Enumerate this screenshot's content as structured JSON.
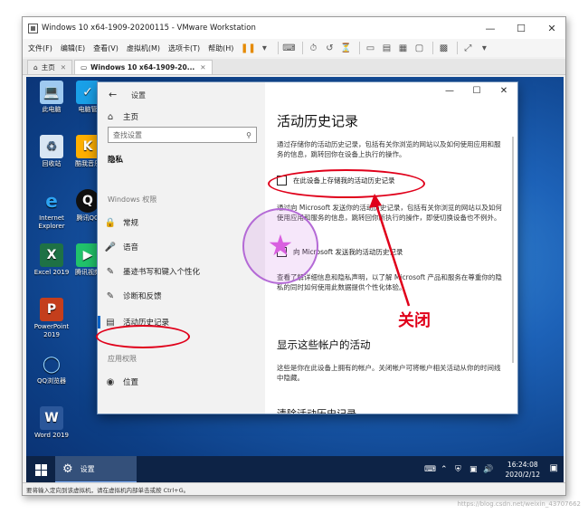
{
  "window": {
    "title": "Windows 10 x64-1909-20200115 - VMware Workstation"
  },
  "menubar": {
    "items": [
      "文件(F)",
      "编辑(E)",
      "查看(V)",
      "虚拟机(M)",
      "选项卡(T)",
      "帮助(H)"
    ],
    "toolbar_icons": [
      "pause-icon",
      "send-keys-icon",
      "snapshot-icon",
      "revert-icon",
      "snapshot-manager-icon",
      "full-screen-icon",
      "unity-icon",
      "console-icon",
      "view-icon"
    ]
  },
  "tabs": [
    {
      "label": "主页",
      "icon": "home-icon"
    },
    {
      "label": "Windows 10 x64-1909-20...",
      "icon": "vm-icon"
    }
  ],
  "desktop_icons": [
    {
      "label": "此电脑",
      "icon": "computer-icon"
    },
    {
      "label": "电脑管",
      "icon": "shield-app-icon"
    },
    {
      "label": "回收站",
      "icon": "recycle-bin-icon"
    },
    {
      "label": "酷我音乐",
      "icon": "music-app-icon"
    },
    {
      "label": "Internet Explorer",
      "icon": "ie-icon"
    },
    {
      "label": "腾讯QQ",
      "icon": "qq-icon"
    },
    {
      "label": "Excel 2019",
      "icon": "excel-icon"
    },
    {
      "label": "腾讯视频",
      "icon": "video-app-icon"
    },
    {
      "label": "PowerPoint 2019",
      "icon": "powerpoint-icon"
    },
    {
      "label": "QQ浏览器",
      "icon": "qq-browser-icon"
    },
    {
      "label": "Word 2019",
      "icon": "word-icon"
    }
  ],
  "settings": {
    "app_title": "设置",
    "nav": {
      "home": "主页",
      "search_placeholder": "查找设置",
      "category": "隐私",
      "group_windows": "Windows 权限",
      "items": [
        "常规",
        "语音",
        "墨迹书写和键入个性化",
        "诊断和反馈",
        "活动历史记录"
      ],
      "group_app": "应用权限",
      "item_location": "位置"
    },
    "content": {
      "title": "活动历史记录",
      "desc1": "通过存储你的活动历史记录，包括有关你浏览的网站以及如何使用应用和服务的信息，跳转回你在设备上执行的操作。",
      "chk1": "在此设备上存储我的活动历史记录",
      "desc2": "通过向 Microsoft 发送你的活动历史记录，包括有关你浏览的网站以及如何使用应用和服务的信息，跳转回你所执行的操作，即使切换设备也不例外。",
      "chk2": "向 Microsoft 发送我的活动历史记录",
      "desc3": "查看了解详细信息和隐私声明，以了解 Microsoft 产品和服务在尊重你的隐私的同时如何使用此数据提供个性化体验。",
      "section2_title": "显示这些帐户的活动",
      "section2_desc": "这些是你在此设备上拥有的帐户。关闭帐户可将帐户相关活动从你的时间线中隐藏。",
      "section3_title": "清除活动历史记录"
    }
  },
  "annotation": {
    "label": "关闭",
    "color": "#e0001a"
  },
  "taskbar": {
    "app_label": "设置",
    "time": "16:24:08",
    "date": "2020/2/12"
  },
  "statusbar": {
    "text": "要将输入定向到该虚拟机，请在虚拟机内部单击或按 Ctrl+G。"
  },
  "watermark": "https://blog.csdn.net/weixin_43707662"
}
